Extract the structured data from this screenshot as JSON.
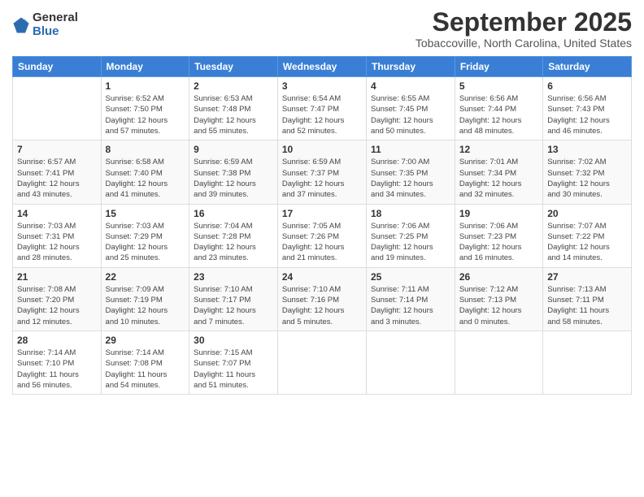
{
  "logo": {
    "general": "General",
    "blue": "Blue"
  },
  "title": "September 2025",
  "location": "Tobaccoville, North Carolina, United States",
  "weekdays": [
    "Sunday",
    "Monday",
    "Tuesday",
    "Wednesday",
    "Thursday",
    "Friday",
    "Saturday"
  ],
  "weeks": [
    [
      {
        "day": "",
        "info": ""
      },
      {
        "day": "1",
        "info": "Sunrise: 6:52 AM\nSunset: 7:50 PM\nDaylight: 12 hours\nand 57 minutes."
      },
      {
        "day": "2",
        "info": "Sunrise: 6:53 AM\nSunset: 7:48 PM\nDaylight: 12 hours\nand 55 minutes."
      },
      {
        "day": "3",
        "info": "Sunrise: 6:54 AM\nSunset: 7:47 PM\nDaylight: 12 hours\nand 52 minutes."
      },
      {
        "day": "4",
        "info": "Sunrise: 6:55 AM\nSunset: 7:45 PM\nDaylight: 12 hours\nand 50 minutes."
      },
      {
        "day": "5",
        "info": "Sunrise: 6:56 AM\nSunset: 7:44 PM\nDaylight: 12 hours\nand 48 minutes."
      },
      {
        "day": "6",
        "info": "Sunrise: 6:56 AM\nSunset: 7:43 PM\nDaylight: 12 hours\nand 46 minutes."
      }
    ],
    [
      {
        "day": "7",
        "info": "Sunrise: 6:57 AM\nSunset: 7:41 PM\nDaylight: 12 hours\nand 43 minutes."
      },
      {
        "day": "8",
        "info": "Sunrise: 6:58 AM\nSunset: 7:40 PM\nDaylight: 12 hours\nand 41 minutes."
      },
      {
        "day": "9",
        "info": "Sunrise: 6:59 AM\nSunset: 7:38 PM\nDaylight: 12 hours\nand 39 minutes."
      },
      {
        "day": "10",
        "info": "Sunrise: 6:59 AM\nSunset: 7:37 PM\nDaylight: 12 hours\nand 37 minutes."
      },
      {
        "day": "11",
        "info": "Sunrise: 7:00 AM\nSunset: 7:35 PM\nDaylight: 12 hours\nand 34 minutes."
      },
      {
        "day": "12",
        "info": "Sunrise: 7:01 AM\nSunset: 7:34 PM\nDaylight: 12 hours\nand 32 minutes."
      },
      {
        "day": "13",
        "info": "Sunrise: 7:02 AM\nSunset: 7:32 PM\nDaylight: 12 hours\nand 30 minutes."
      }
    ],
    [
      {
        "day": "14",
        "info": "Sunrise: 7:03 AM\nSunset: 7:31 PM\nDaylight: 12 hours\nand 28 minutes."
      },
      {
        "day": "15",
        "info": "Sunrise: 7:03 AM\nSunset: 7:29 PM\nDaylight: 12 hours\nand 25 minutes."
      },
      {
        "day": "16",
        "info": "Sunrise: 7:04 AM\nSunset: 7:28 PM\nDaylight: 12 hours\nand 23 minutes."
      },
      {
        "day": "17",
        "info": "Sunrise: 7:05 AM\nSunset: 7:26 PM\nDaylight: 12 hours\nand 21 minutes."
      },
      {
        "day": "18",
        "info": "Sunrise: 7:06 AM\nSunset: 7:25 PM\nDaylight: 12 hours\nand 19 minutes."
      },
      {
        "day": "19",
        "info": "Sunrise: 7:06 AM\nSunset: 7:23 PM\nDaylight: 12 hours\nand 16 minutes."
      },
      {
        "day": "20",
        "info": "Sunrise: 7:07 AM\nSunset: 7:22 PM\nDaylight: 12 hours\nand 14 minutes."
      }
    ],
    [
      {
        "day": "21",
        "info": "Sunrise: 7:08 AM\nSunset: 7:20 PM\nDaylight: 12 hours\nand 12 minutes."
      },
      {
        "day": "22",
        "info": "Sunrise: 7:09 AM\nSunset: 7:19 PM\nDaylight: 12 hours\nand 10 minutes."
      },
      {
        "day": "23",
        "info": "Sunrise: 7:10 AM\nSunset: 7:17 PM\nDaylight: 12 hours\nand 7 minutes."
      },
      {
        "day": "24",
        "info": "Sunrise: 7:10 AM\nSunset: 7:16 PM\nDaylight: 12 hours\nand 5 minutes."
      },
      {
        "day": "25",
        "info": "Sunrise: 7:11 AM\nSunset: 7:14 PM\nDaylight: 12 hours\nand 3 minutes."
      },
      {
        "day": "26",
        "info": "Sunrise: 7:12 AM\nSunset: 7:13 PM\nDaylight: 12 hours\nand 0 minutes."
      },
      {
        "day": "27",
        "info": "Sunrise: 7:13 AM\nSunset: 7:11 PM\nDaylight: 11 hours\nand 58 minutes."
      }
    ],
    [
      {
        "day": "28",
        "info": "Sunrise: 7:14 AM\nSunset: 7:10 PM\nDaylight: 11 hours\nand 56 minutes."
      },
      {
        "day": "29",
        "info": "Sunrise: 7:14 AM\nSunset: 7:08 PM\nDaylight: 11 hours\nand 54 minutes."
      },
      {
        "day": "30",
        "info": "Sunrise: 7:15 AM\nSunset: 7:07 PM\nDaylight: 11 hours\nand 51 minutes."
      },
      {
        "day": "",
        "info": ""
      },
      {
        "day": "",
        "info": ""
      },
      {
        "day": "",
        "info": ""
      },
      {
        "day": "",
        "info": ""
      }
    ]
  ]
}
